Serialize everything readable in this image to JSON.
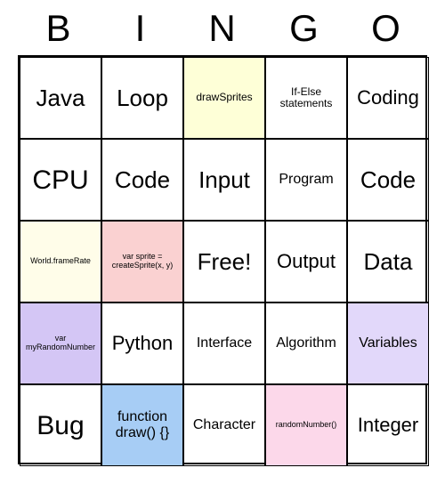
{
  "header": [
    "B",
    "I",
    "N",
    "G",
    "O"
  ],
  "cells": [
    {
      "text": "Java",
      "size": "xl",
      "bg": ""
    },
    {
      "text": "Loop",
      "size": "xl",
      "bg": ""
    },
    {
      "text": "drawSprites",
      "size": "small",
      "bg": "bg-yellow"
    },
    {
      "text": "If-Else statements",
      "size": "small",
      "bg": ""
    },
    {
      "text": "Coding",
      "size": "lg",
      "bg": ""
    },
    {
      "text": "CPU",
      "size": "xxl",
      "bg": ""
    },
    {
      "text": "Code",
      "size": "xl",
      "bg": ""
    },
    {
      "text": "Input",
      "size": "xl",
      "bg": ""
    },
    {
      "text": "Program",
      "size": "med",
      "bg": ""
    },
    {
      "text": "Code",
      "size": "xl",
      "bg": ""
    },
    {
      "text": "World.frameRate",
      "size": "tiny",
      "bg": "bg-paleyellow"
    },
    {
      "text": "var sprite = createSprite(x, y)",
      "size": "tiny",
      "bg": "bg-pink"
    },
    {
      "text": "Free!",
      "size": "xl",
      "bg": ""
    },
    {
      "text": "Output",
      "size": "lg",
      "bg": ""
    },
    {
      "text": "Data",
      "size": "xl",
      "bg": ""
    },
    {
      "text": "var myRandomNumber",
      "size": "tiny",
      "bg": "bg-purple"
    },
    {
      "text": "Python",
      "size": "lg",
      "bg": ""
    },
    {
      "text": "Interface",
      "size": "med",
      "bg": ""
    },
    {
      "text": "Algorithm",
      "size": "med",
      "bg": ""
    },
    {
      "text": "Variables",
      "size": "med",
      "bg": "bg-lightpurple"
    },
    {
      "text": "Bug",
      "size": "xxl",
      "bg": ""
    },
    {
      "text": "function draw() {}",
      "size": "med",
      "bg": "bg-blue"
    },
    {
      "text": "Character",
      "size": "med",
      "bg": ""
    },
    {
      "text": "randomNumber()",
      "size": "tiny",
      "bg": "bg-lightpink"
    },
    {
      "text": "Integer",
      "size": "lg",
      "bg": ""
    }
  ]
}
